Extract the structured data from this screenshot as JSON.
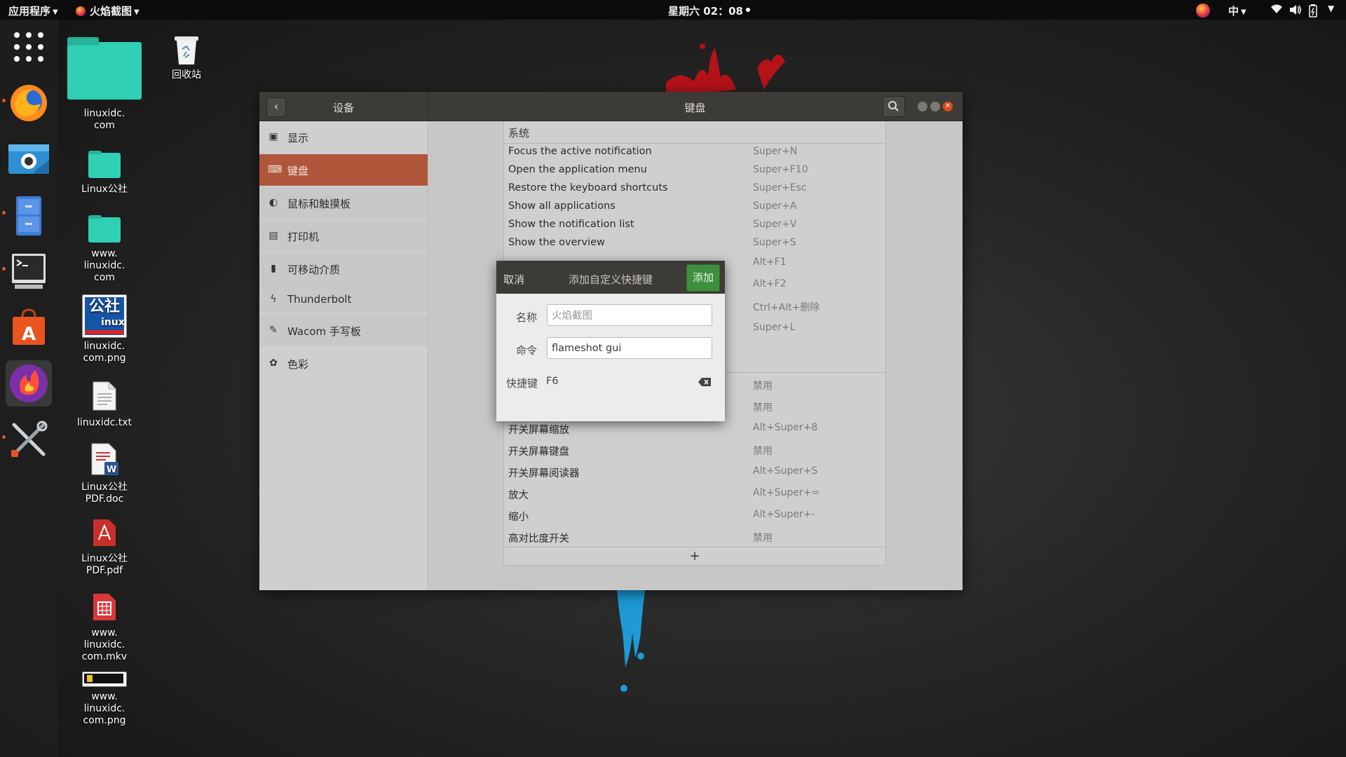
{
  "topbar": {
    "apps_label": "应用程序",
    "active_app": "火焰截图",
    "clock": "星期六 02：08",
    "ime": "中"
  },
  "dock": {
    "items": [
      "app-grid-icon",
      "firefox-icon",
      "screenshot-camera-icon",
      "file-cabinet-icon",
      "terminal-icon",
      "software-center-icon",
      "flameshot-icon",
      "settings-tools-icon"
    ]
  },
  "desktop": {
    "icons": [
      {
        "label_lines": [
          "linuxidc.",
          "com"
        ]
      },
      {
        "label_lines": [
          "回收站"
        ]
      },
      {
        "label_lines": [
          "Linux公社"
        ]
      },
      {
        "label_lines": [
          "www.",
          "linuxidc.",
          "com"
        ]
      },
      {
        "label_lines": [
          "linuxidc.",
          "com.png"
        ]
      },
      {
        "label_lines": [
          "linuxidc.txt"
        ]
      },
      {
        "label_lines": [
          "Linux公社",
          "PDF.doc"
        ]
      },
      {
        "label_lines": [
          "Linux公社",
          "PDF.pdf"
        ]
      },
      {
        "label_lines": [
          "www.",
          "linuxidc.",
          "com.mkv"
        ]
      },
      {
        "label_lines": [
          "www.",
          "linuxidc.",
          "com.png"
        ]
      }
    ],
    "logo_text": "公社",
    "logo_sub": "inux"
  },
  "window": {
    "left_title": "设备",
    "title": "键盘",
    "sidebar": [
      {
        "icon": "display-icon",
        "label": "显示"
      },
      {
        "icon": "keyboard-icon",
        "label": "键盘"
      },
      {
        "icon": "mouse-icon",
        "label": "鼠标和触摸板"
      },
      {
        "icon": "printer-icon",
        "label": "打印机"
      },
      {
        "icon": "removable-media-icon",
        "label": "可移动介质"
      },
      {
        "icon": "thunderbolt-icon",
        "label": "Thunderbolt"
      },
      {
        "icon": "wacom-tablet-icon",
        "label": "Wacom 手写板"
      },
      {
        "icon": "color-icon",
        "label": "色彩"
      }
    ],
    "active_sidebar": 1,
    "section_header": "系统",
    "shortcuts_top": [
      {
        "name": "Focus the active notification",
        "keys": "Super+N"
      },
      {
        "name": "Open the application menu",
        "keys": "Super+F10"
      },
      {
        "name": "Restore the keyboard shortcuts",
        "keys": "Super+Esc"
      },
      {
        "name": "Show all applications",
        "keys": "Super+A"
      },
      {
        "name": "Show the notification list",
        "keys": "Super+V"
      },
      {
        "name": "Show the overview",
        "keys": "Super+S"
      }
    ],
    "shortcuts_hidden": [
      {
        "keys": "Alt+F1"
      },
      {
        "keys": "Alt+F2"
      },
      {
        "keys": "Ctrl+Alt+删除"
      },
      {
        "keys": "Super+L"
      }
    ],
    "shortcuts_access": [
      {
        "name": "",
        "keys": "禁用"
      },
      {
        "name": "",
        "keys": "禁用"
      },
      {
        "name": "开关屏幕缩放",
        "keys": "Alt+Super+8"
      },
      {
        "name": "开关屏幕键盘",
        "keys": "禁用"
      },
      {
        "name": "开关屏幕阅读器",
        "keys": "Alt+Super+S"
      },
      {
        "name": "放大",
        "keys": "Alt+Super+="
      },
      {
        "name": "缩小",
        "keys": "Alt+Super+-"
      },
      {
        "name": "高对比度开关",
        "keys": "禁用"
      }
    ],
    "add_row_label": "+"
  },
  "dialog": {
    "cancel": "取消",
    "title": "添加自定义快捷键",
    "add": "添加",
    "name_label": "名称",
    "name_value": "火焰截图",
    "command_label": "命令",
    "command_value": "flameshot gui",
    "shortcut_label": "快捷键",
    "shortcut_value": "F6"
  },
  "colors": {
    "accent": "#b0563a",
    "add_button": "#3d8f3d",
    "folder": "#2fd0b3",
    "header": "#3c3b37"
  }
}
